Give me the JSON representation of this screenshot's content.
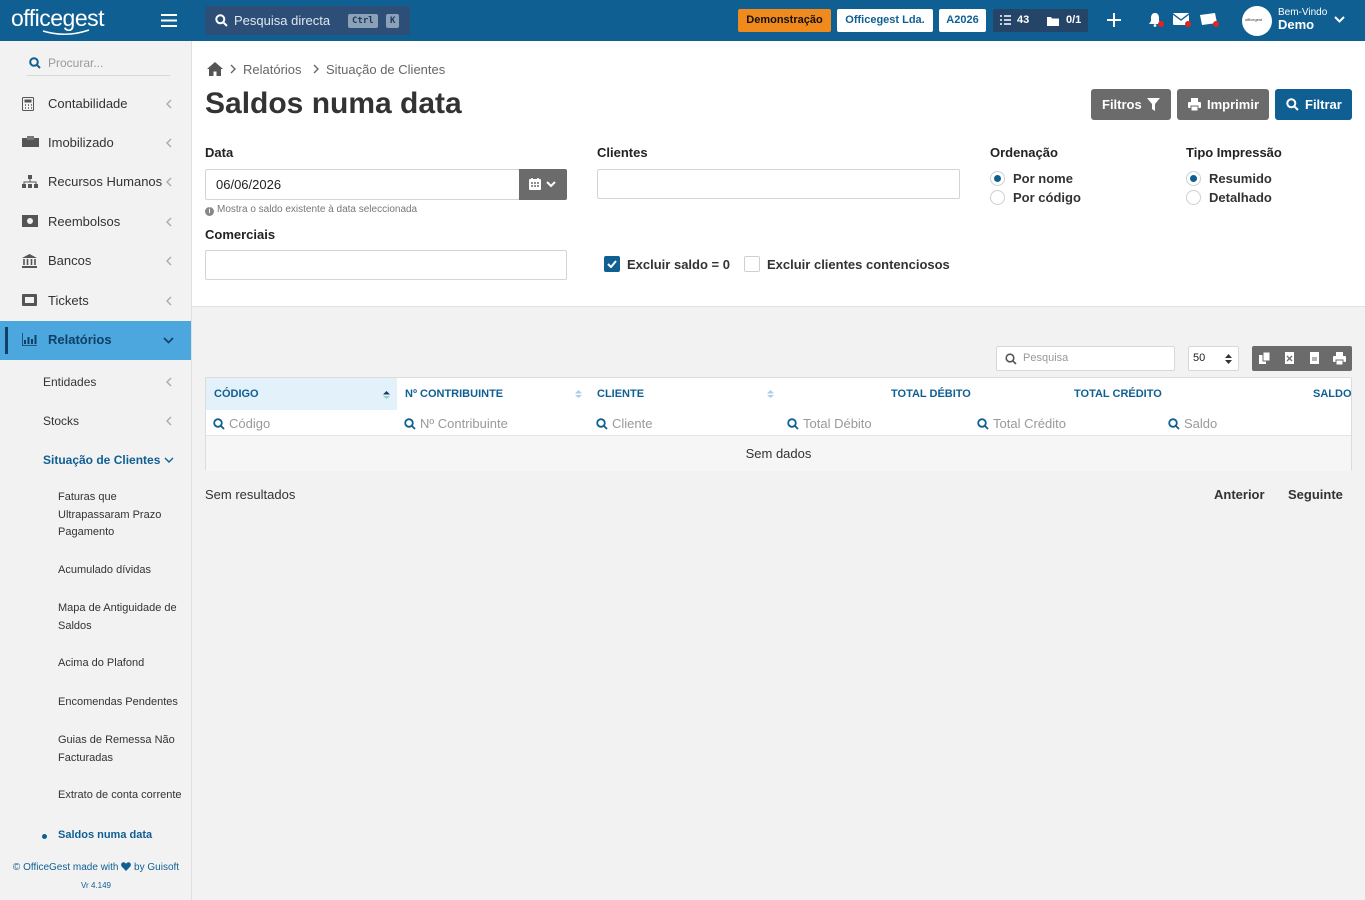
{
  "brand": {
    "logo_text": "officegest"
  },
  "topbar": {
    "search_placeholder": "Pesquisa directa",
    "kbd_ctrl": "Ctrl",
    "kbd_k": "K",
    "demo_badge": "Demonstração",
    "company": "Officegest Lda.",
    "year": "A2026",
    "tasks_count": "43",
    "docs_count": "0/1",
    "welcome": "Bem-Vindo",
    "user": "Demo",
    "avatar_text": "officegest",
    "colors": {
      "bar": "#0f5f93",
      "demo": "#f08a1c",
      "alert": "#e02424"
    }
  },
  "sidebar": {
    "search_placeholder": "Procurar...",
    "items": [
      {
        "label": "Contabilidade",
        "icon": "calculator-icon"
      },
      {
        "label": "Imobilizado",
        "icon": "boxes-icon"
      },
      {
        "label": "Recursos Humanos",
        "icon": "org-chart-icon"
      },
      {
        "label": "Reembolsos",
        "icon": "money-bill-icon"
      },
      {
        "label": "Bancos",
        "icon": "bank-icon"
      },
      {
        "label": "Tickets",
        "icon": "ticket-icon"
      },
      {
        "label": "Relatórios",
        "icon": "chart-icon",
        "active": true
      }
    ],
    "sub": {
      "entidades": "Entidades",
      "stocks": "Stocks",
      "situacao": "Situação de Clientes",
      "children": [
        "Faturas que Ultrapassaram Prazo Pagamento",
        "Acumulado dívidas",
        "Mapa de Antiguidade de Saldos",
        "Acima do Plafond",
        "Encomendas Pendentes",
        "Guias de Remessa Não Facturadas",
        "Extrato de conta corrente",
        "Saldos numa data"
      ]
    },
    "footer_line1": "© OfficeGest made with",
    "footer_by": "by Guisoft",
    "footer_version": "Vr 4.149"
  },
  "breadcrumb": {
    "items": [
      "Relatórios",
      "Situação de Clientes"
    ]
  },
  "page": {
    "title": "Saldos numa data"
  },
  "actions": {
    "filtros": "Filtros",
    "imprimir": "Imprimir",
    "filtrar": "Filtrar"
  },
  "form": {
    "data_label": "Data",
    "data_value": "06/06/2026",
    "data_hint": "Mostra o saldo existente à data seleccionada",
    "clientes_label": "Clientes",
    "comerciais_label": "Comerciais",
    "ordenacao_label": "Ordenação",
    "ordenacao_options": [
      "Por nome",
      "Por código"
    ],
    "ordenacao_selected": "Por nome",
    "tipo_label": "Tipo Impressão",
    "tipo_options": [
      "Resumido",
      "Detalhado"
    ],
    "tipo_selected": "Resumido",
    "excluir_saldo": "Excluir saldo = 0",
    "excluir_saldo_checked": true,
    "excluir_contenciosos": "Excluir clientes contenciosos",
    "excluir_contenciosos_checked": false
  },
  "table": {
    "search_placeholder": "Pesquisa",
    "page_size": "50",
    "export_icons": [
      "copy-icon",
      "excel-icon",
      "pdf-icon",
      "print-icon"
    ],
    "columns": [
      "CÓDIGO",
      "Nº CONTRIBUINTE",
      "CLIENTE",
      "TOTAL DÉBITO",
      "TOTAL CRÉDITO",
      "SALDO"
    ],
    "filters": [
      "Código",
      "Nº Contribuinte",
      "Cliente",
      "Total Débito",
      "Total Crédito",
      "Saldo"
    ],
    "empty": "Sem dados",
    "results": "Sem resultados",
    "prev": "Anterior",
    "next": "Seguinte"
  }
}
